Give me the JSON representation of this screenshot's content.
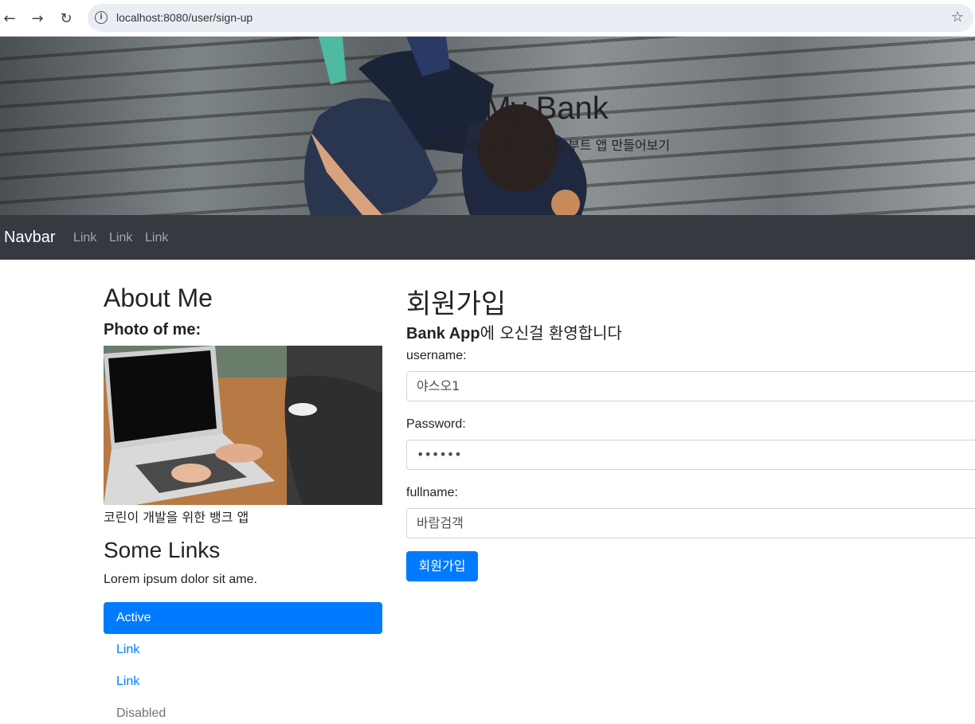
{
  "browser": {
    "url": "localhost:8080/user/sign-up",
    "back_icon": "←",
    "forward_icon": "→",
    "reload_icon": "↻",
    "info_icon": "i",
    "bookmark_icon": "☆"
  },
  "hero": {
    "title": "My Bank",
    "subtitle": "코린이 개발을 위한 스프링 부트 앱 만들어보기"
  },
  "navbar": {
    "brand": "Navbar",
    "links": [
      "Link",
      "Link",
      "Link"
    ]
  },
  "sidebar": {
    "about_title": "About Me",
    "photo_title": "Photo of me:",
    "caption": "코린이 개발을 위한 뱅크 앱",
    "links_title": "Some Links",
    "lorem": "Lorem ipsum dolor sit ame.",
    "pills": [
      {
        "label": "Active",
        "state": "active"
      },
      {
        "label": "Link",
        "state": "link"
      },
      {
        "label": "Link",
        "state": "link"
      },
      {
        "label": "Disabled",
        "state": "disabled"
      }
    ]
  },
  "form": {
    "title": "회원가입",
    "welcome_bold": "Bank App",
    "welcome_rest": "에 오신걸 환영합니다",
    "username_label": "username:",
    "username_value": "야스오1",
    "password_label": "Password:",
    "password_value": "••••••",
    "fullname_label": "fullname:",
    "fullname_value": "바람검객",
    "submit_label": "회원가입"
  },
  "colors": {
    "primary": "#007bff",
    "navbar_bg": "#343a40"
  }
}
